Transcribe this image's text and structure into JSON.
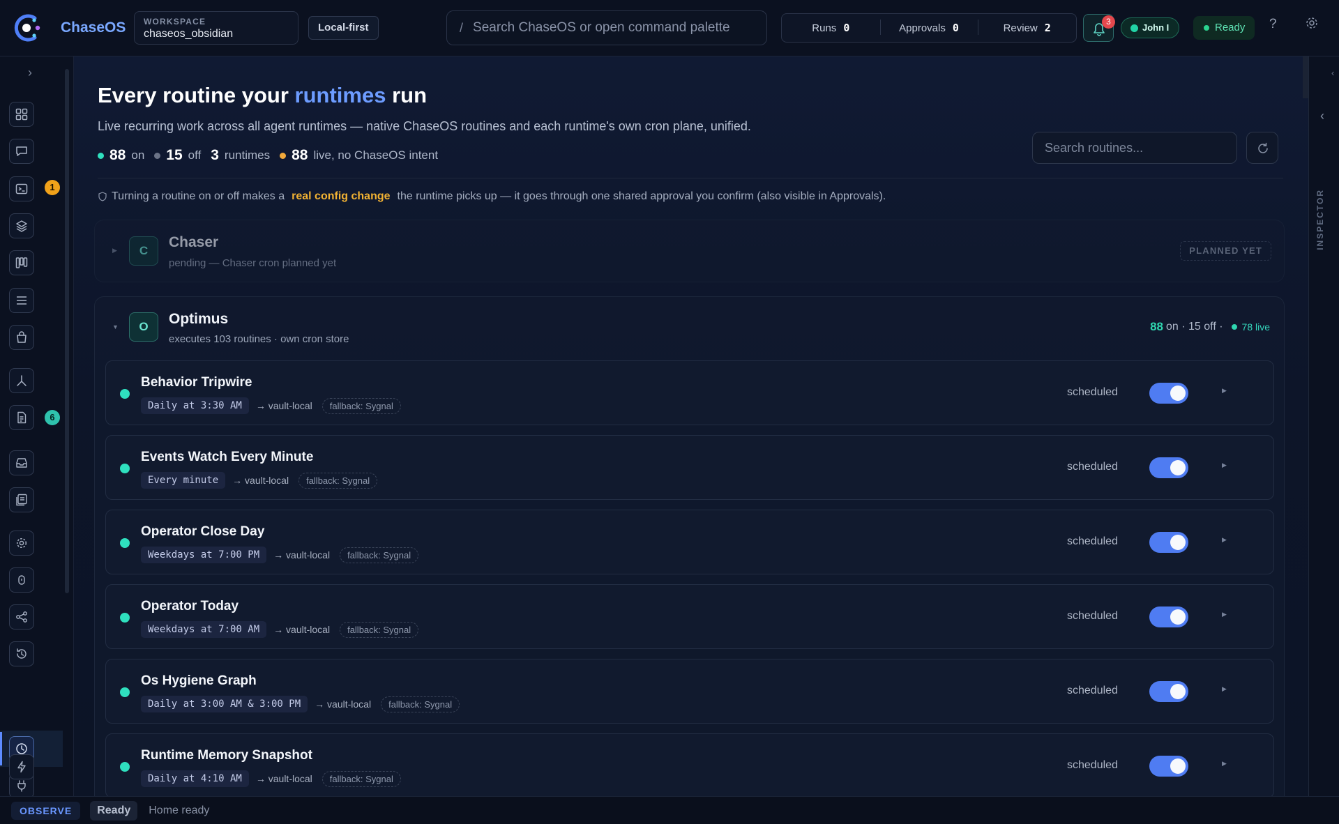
{
  "app": {
    "brand": "ChaseOS"
  },
  "workspace": {
    "label": "WORKSPACE",
    "value": "chaseos_obsidian"
  },
  "badge_local": "Local-first",
  "search": {
    "slash": "/",
    "placeholder": "Search ChaseOS or open command palette"
  },
  "counters": [
    {
      "label": "Runs",
      "value": "0"
    },
    {
      "label": "Approvals",
      "value": "0"
    },
    {
      "label": "Review",
      "value": "2"
    }
  ],
  "notifications": {
    "count": "3"
  },
  "user": {
    "name": "John I"
  },
  "status_pill": "Ready",
  "help_glyph": "?",
  "rail": {
    "expand_glyph": "›",
    "badges": {
      "terminal": "1",
      "docs": "6"
    }
  },
  "page": {
    "title_pre": "Every routine your ",
    "title_accent": "runtimes",
    "title_post": " run",
    "subtitle": "Live recurring work across all agent runtimes — native ChaseOS routines and each runtime's own cron plane, unified.",
    "stats": {
      "on_count": "88",
      "on_label": "on",
      "off_count": "15",
      "off_label": "off",
      "runtimes_count": "3",
      "runtimes_label": "runtimes",
      "live_count": "88",
      "live_label": "live, no ChaseOS intent"
    },
    "search_placeholder": "Search routines...",
    "notice": {
      "pre": "Turning a routine on or off makes a",
      "highlight": "real config change",
      "post": "the runtime picks up — it goes through one shared approval you confirm (also visible in Approvals)."
    }
  },
  "colors": {
    "accent": "#6d9cff",
    "on": "#2fe0bf",
    "off": "#6b7387",
    "live": "#f2a93b",
    "toggle": "#4f7cf2"
  },
  "runtimes": [
    {
      "initial": "C",
      "name": "Chaser",
      "subtitle": "pending — Chaser cron planned yet",
      "tag": "PLANNED YET",
      "expanded": false
    },
    {
      "initial": "O",
      "name": "Optimus",
      "subtitle": "executes 103 routines · own cron store",
      "expanded": true,
      "summary": {
        "on": "88",
        "rest": " on · 15 off ·",
        "live": "78 live"
      },
      "routines": [
        {
          "name": "Behavior Tripwire",
          "schedule": "Daily at 3:30 AM",
          "target": "→ vault-local",
          "fallback": "fallback: Sygnal",
          "state": "scheduled",
          "enabled": true
        },
        {
          "name": "Events Watch Every Minute",
          "schedule": "Every minute",
          "target": "→ vault-local",
          "fallback": "fallback: Sygnal",
          "state": "scheduled",
          "enabled": true
        },
        {
          "name": "Operator Close Day",
          "schedule": "Weekdays at 7:00 PM",
          "target": "→ vault-local",
          "fallback": "fallback: Sygnal",
          "state": "scheduled",
          "enabled": true
        },
        {
          "name": "Operator Today",
          "schedule": "Weekdays at 7:00 AM",
          "target": "→ vault-local",
          "fallback": "fallback: Sygnal",
          "state": "scheduled",
          "enabled": true
        },
        {
          "name": "Os Hygiene Graph",
          "schedule": "Daily at 3:00 AM & 3:00 PM",
          "target": "→ vault-local",
          "fallback": "fallback: Sygnal",
          "state": "scheduled",
          "enabled": true
        },
        {
          "name": "Runtime Memory Snapshot",
          "schedule": "Daily at 4:10 AM",
          "target": "→ vault-local",
          "fallback": "fallback: Sygnal",
          "state": "scheduled",
          "enabled": true
        }
      ]
    }
  ],
  "inspector": {
    "label": "INSPECTOR"
  },
  "statusbar": {
    "mode": "OBSERVE",
    "state": "Ready",
    "message": "Home ready"
  }
}
